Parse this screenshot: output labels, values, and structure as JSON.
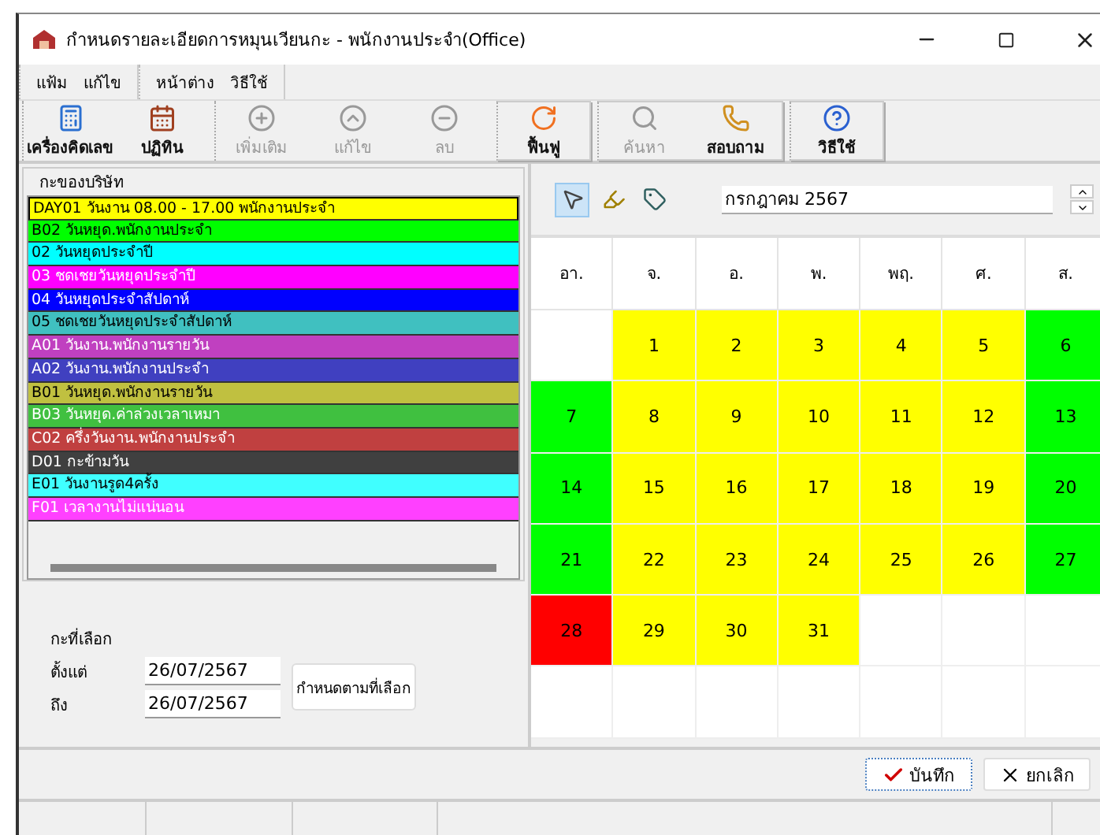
{
  "window": {
    "title": "กำหนดรายละเอียดการหมุนเวียนกะ - พนักงานประจำ(Office)"
  },
  "menu": [
    {
      "items": [
        "แฟ้ม",
        "แก้ไข"
      ]
    },
    {
      "items": [
        "หน้าต่าง",
        "วิธีใช้"
      ]
    }
  ],
  "toolbar": [
    {
      "boxed": false,
      "buttons": [
        {
          "label": "เครื่องคิดเลข",
          "disabled": false
        },
        {
          "label": "ปฏิทิน",
          "disabled": false
        }
      ]
    },
    {
      "boxed": false,
      "buttons": [
        {
          "label": "เพิ่มเติม",
          "disabled": true
        },
        {
          "label": "แก้ไข",
          "disabled": true
        },
        {
          "label": "ลบ",
          "disabled": true
        }
      ]
    },
    {
      "boxed": true,
      "buttons": [
        {
          "label": "ฟื้นฟู",
          "disabled": false
        }
      ]
    },
    {
      "boxed": true,
      "buttons": [
        {
          "label": "ค้นหา",
          "disabled": true
        },
        {
          "label": "สอบถาม",
          "disabled": false
        }
      ]
    },
    {
      "boxed": true,
      "buttons": [
        {
          "label": "วิธีใช้",
          "disabled": false
        }
      ]
    }
  ],
  "shifts": {
    "title": "กะของบริษัท",
    "items": [
      {
        "label": "DAY01 วันงาน 08.00 - 17.00 พนักงานประจำ",
        "color": "#ffff00",
        "selected": true
      },
      {
        "label": "B02 วันหยุด.พนักงานประจำ",
        "color": "#00ff00",
        "selected": false
      },
      {
        "label": "02 วันหยุดประจำปี",
        "color": "#00ffff",
        "selected": false
      },
      {
        "label": "03 ชดเชยวันหยุดประจำปี",
        "color": "#ff00ff",
        "selected": false
      },
      {
        "label": "04 วันหยุดประจำสัปดาห์",
        "color": "#0000ff",
        "selected": false
      },
      {
        "label": "05 ชดเชยวันหยุดประจำสัปดาห์",
        "color": "#40c0c0",
        "selected": false
      },
      {
        "label": "A01 วันงาน.พนักงานรายวัน",
        "color": "#c040c0",
        "selected": false
      },
      {
        "label": "A02 วันงาน.พนักงานประจำ",
        "color": "#4040c0",
        "selected": false
      },
      {
        "label": "B01 วันหยุด.พนักงานรายวัน",
        "color": "#c0c040",
        "selected": false
      },
      {
        "label": "B03 วันหยุด.ค่าล่วงเวลาเหมา",
        "color": "#40c040",
        "selected": false
      },
      {
        "label": "C02 ครึ่งวันงาน.พนักงานประจำ",
        "color": "#c04040",
        "selected": false
      },
      {
        "label": "D01 กะข้ามวัน",
        "color": "#404040",
        "selected": false
      },
      {
        "label": "E01 วันงานรูด4ครั้ง",
        "color": "#40ffff",
        "selected": false
      },
      {
        "label": "F01 เวลางานไม่แน่นอน",
        "color": "#ff40ff",
        "selected": false
      }
    ]
  },
  "selection": {
    "title": "กะที่เลือก",
    "from_label": "ตั้งแต่",
    "from": "26/07/2567",
    "to_label": "ถึง",
    "to": "26/07/2567",
    "apply_button": "กำหนดตามที่เลือก"
  },
  "calendar": {
    "tools": [
      {
        "selected": true
      },
      {
        "selected": false
      },
      {
        "selected": false
      }
    ],
    "month": "กรกฎาคม 2567",
    "weekdays": [
      "อา.",
      "จ.",
      "อ.",
      "พ.",
      "พฤ.",
      "ศ.",
      "ส."
    ],
    "weeks": [
      [
        {
          "kind": "blank"
        },
        {
          "kind": "day",
          "day": "1",
          "color": "#ffff00"
        },
        {
          "day": "2",
          "color": "#ffff00"
        },
        {
          "day": "3",
          "color": "#ffff00"
        },
        {
          "day": "4",
          "color": "#ffff00"
        },
        {
          "day": "5",
          "color": "#ffff00"
        },
        {
          "day": "6",
          "color": "#00ff00"
        }
      ],
      [
        {
          "day": "7",
          "color": "#00ff00"
        },
        {
          "day": "8",
          "color": "#ffff00"
        },
        {
          "day": "9",
          "color": "#ffff00"
        },
        {
          "day": "10",
          "color": "#ffff00"
        },
        {
          "day": "11",
          "color": "#ffff00"
        },
        {
          "day": "12",
          "color": "#ffff00"
        },
        {
          "day": "13",
          "color": "#00ff00"
        }
      ],
      [
        {
          "day": "14",
          "color": "#00ff00"
        },
        {
          "day": "15",
          "color": "#ffff00"
        },
        {
          "day": "16",
          "color": "#ffff00"
        },
        {
          "day": "17",
          "color": "#ffff00"
        },
        {
          "day": "18",
          "color": "#ffff00"
        },
        {
          "day": "19",
          "color": "#ffff00"
        },
        {
          "day": "20",
          "color": "#00ff00"
        }
      ],
      [
        {
          "day": "21",
          "color": "#00ff00"
        },
        {
          "day": "22",
          "color": "#ffff00"
        },
        {
          "day": "23",
          "color": "#ffff00"
        },
        {
          "day": "24",
          "color": "#ffff00"
        },
        {
          "day": "25",
          "color": "#ffff00"
        },
        {
          "day": "26",
          "color": "#ffff00"
        },
        {
          "day": "27",
          "color": "#00ff00"
        }
      ],
      [
        {
          "day": "28",
          "color": "#ff0000"
        },
        {
          "day": "29",
          "color": "#ffff00"
        },
        {
          "day": "30",
          "color": "#ffff00"
        },
        {
          "day": "31",
          "color": "#ffff00"
        },
        {
          "kind": "blank"
        },
        {
          "kind": "blank"
        },
        {
          "kind": "blank"
        }
      ],
      [
        {
          "kind": "blank"
        },
        {
          "kind": "blank"
        },
        {
          "kind": "blank"
        },
        {
          "kind": "blank"
        },
        {
          "kind": "blank"
        },
        {
          "kind": "blank"
        },
        {
          "kind": "blank"
        }
      ]
    ]
  },
  "buttons": {
    "save": "บันทึก",
    "cancel": "ยกเลิก"
  }
}
